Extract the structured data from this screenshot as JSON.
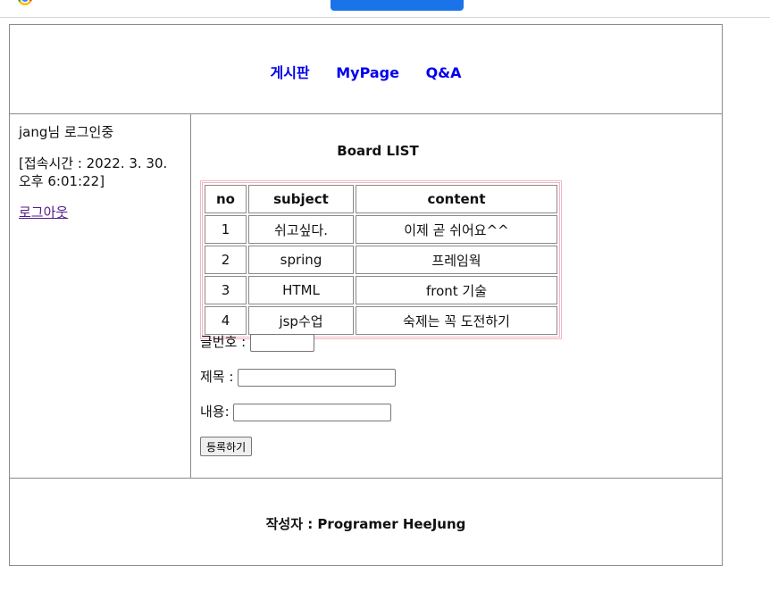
{
  "header": {
    "nav": [
      {
        "label": "게시판"
      },
      {
        "label": "MyPage"
      },
      {
        "label": "Q&A"
      }
    ]
  },
  "sidebar": {
    "login_status": "jang님 로그인중",
    "access_time": "[접속시간 : 2022. 3. 30. 오후 6:01:22]",
    "logout_label": "로그아웃"
  },
  "board": {
    "title": "Board LIST",
    "columns": [
      "no",
      "subject",
      "content"
    ],
    "rows": [
      {
        "no": "1",
        "subject": "쉬고싶다.",
        "content": "이제 곧 쉬어요^^"
      },
      {
        "no": "2",
        "subject": "spring",
        "content": "프레임웍"
      },
      {
        "no": "3",
        "subject": "HTML",
        "content": "front 기술"
      },
      {
        "no": "4",
        "subject": "jsp수업",
        "content": "숙제는 꼭 도전하기"
      }
    ]
  },
  "form": {
    "no_label": "글번호 :",
    "no_value": "",
    "subject_label": "제목 :",
    "subject_value": "",
    "content_label": "내용:",
    "content_value": "",
    "submit_label": "등록하기"
  },
  "footer": {
    "author": "작성자 : Programer HeeJung"
  },
  "colors": {
    "link": "#0000ee",
    "visited_link": "#551a8b",
    "table_border": "#f4b6c2",
    "frame_border": "#8a8a8a"
  }
}
